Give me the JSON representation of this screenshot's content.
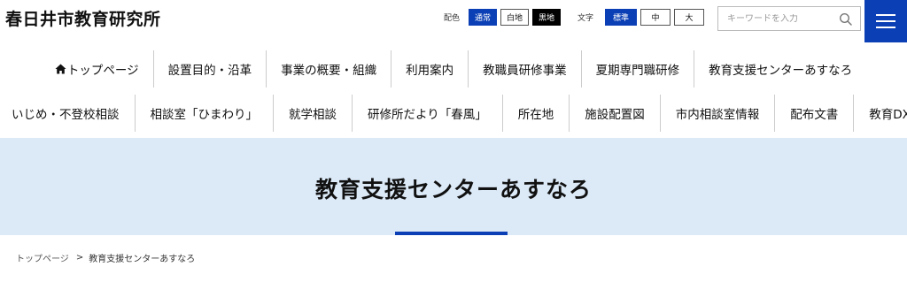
{
  "site": {
    "title": "春日井市教育研究所"
  },
  "toolbar": {
    "color_label": "配色",
    "color_options": [
      "通常",
      "白地",
      "黒地"
    ],
    "text_label": "文字",
    "text_options": [
      "標準",
      "中",
      "大"
    ]
  },
  "search": {
    "placeholder": "キーワードを入力",
    "icon": "search-icon"
  },
  "menu_button": {
    "icon": "hamburger-menu-icon"
  },
  "nav": {
    "row1": [
      "トップページ",
      "設置目的・沿革",
      "事業の概要・組織",
      "利用案内",
      "教職員研修事業",
      "夏期専門職研修",
      "教育支援センターあすなろ"
    ],
    "row2": [
      "いじめ・不登校相談",
      "相談室「ひまわり」",
      "就学相談",
      "研修所だより「春風」",
      "所在地",
      "施設配置図",
      "市内相談室情報",
      "配布文書",
      "教育DX"
    ]
  },
  "page": {
    "title": "教育支援センターあすなろ"
  },
  "breadcrumb": {
    "home": "トップページ",
    "separator": ">",
    "current": "教育支援センターあすなろ"
  },
  "colors": {
    "accent": "#0b3fb5",
    "banner_bg": "#dceaf8"
  }
}
